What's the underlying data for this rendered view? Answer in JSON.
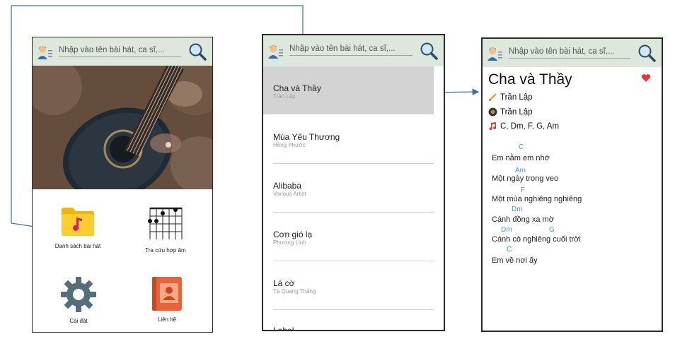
{
  "search": {
    "placeholder": "Nhập vào tên bài hát, ca sĩ,..."
  },
  "home": {
    "tiles": [
      {
        "label": "Danh sách bài hát"
      },
      {
        "label": "Tra cứu hợp âm"
      },
      {
        "label": "Cài đặt"
      },
      {
        "label": "Liên hệ"
      }
    ]
  },
  "songs": [
    {
      "title": "Cha và Thầy",
      "artist": "Trần Lập"
    },
    {
      "title": "Mùa Yêu Thương",
      "artist": "Hồng Phước"
    },
    {
      "title": "Alibaba",
      "artist": "Various Artist"
    },
    {
      "title": "Cơn gió lạ",
      "artist": "Phương Linh"
    },
    {
      "title": "Lá cờ",
      "artist": "Tạ Quang Thắng"
    },
    {
      "title": "Label",
      "artist": ""
    }
  ],
  "detail": {
    "title": "Cha và Thầy",
    "composer": "Trần Lập",
    "singer": "Trần Lập",
    "chords": "C, Dm, F, G, Am",
    "lines": [
      {
        "chords": [
          "C"
        ],
        "lyric": "Em nằm em nhớ"
      },
      {
        "chords": [
          "Am"
        ],
        "lyric": "Một ngày trong veo"
      },
      {
        "chords": [
          "F"
        ],
        "lyric": "Một mùa nghiêng nghiêng"
      },
      {
        "chords": [
          "Dm"
        ],
        "lyric": "Cánh đồng xa mờ"
      },
      {
        "chords": [
          "Dm",
          "G"
        ],
        "lyric": "Cánh cò nghiêng cuối trời"
      },
      {
        "chords": [
          "C"
        ],
        "lyric": "Em về nơi ấy"
      }
    ]
  },
  "colors": {
    "searchbar": "#dde7db",
    "chord": "#4a90d9",
    "selected_row": "#d3d3d3",
    "heart": "#e53935",
    "connector": "#3d6ea8"
  }
}
